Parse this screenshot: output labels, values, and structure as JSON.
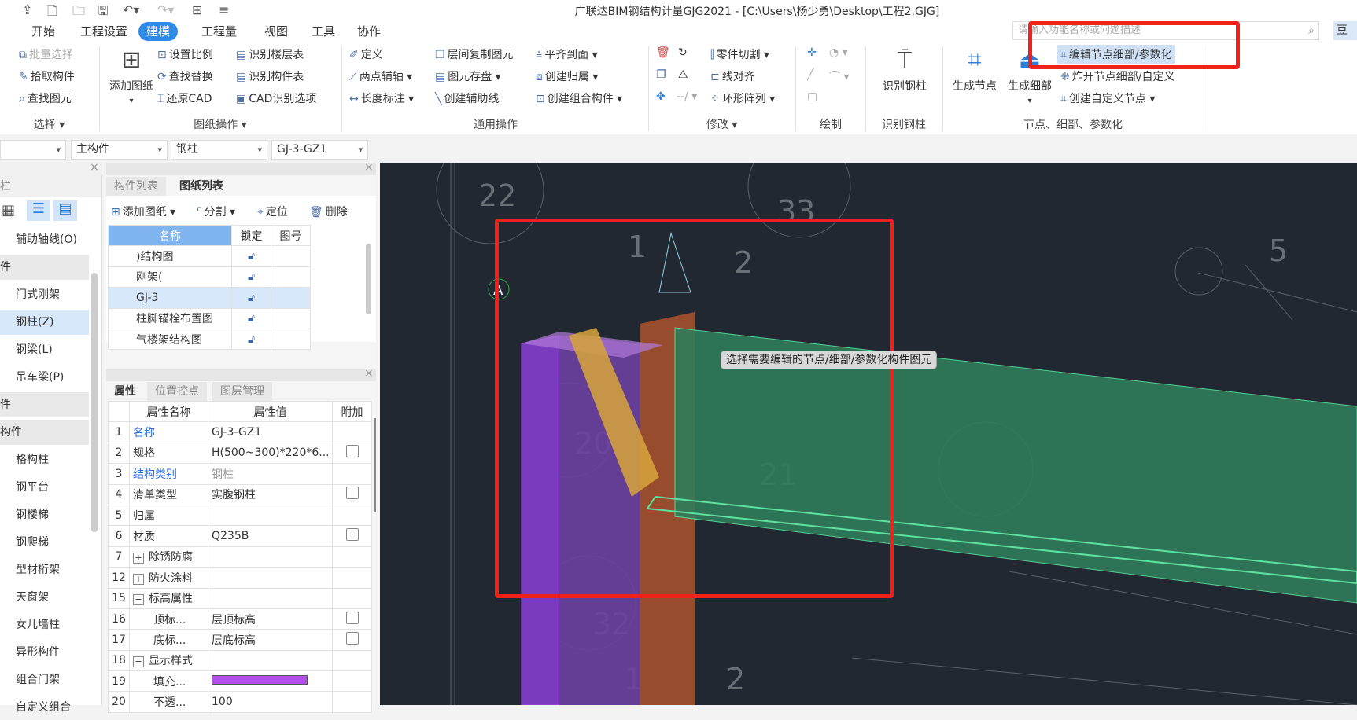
{
  "window": {
    "title": "广联达BIM钢结构计量GJG2021 - [C:\\Users\\杨少勇\\Desktop\\工程2.GJG]"
  },
  "menu_tabs": [
    "开始",
    "工程设置",
    "建模",
    "工程量",
    "视图",
    "工具",
    "协作"
  ],
  "active_tab": "建模",
  "search": {
    "placeholder": "请输入功能名称或问题描述"
  },
  "user_label": "豆",
  "ribbon": {
    "select": {
      "label": "选择",
      "batch": "批量选择",
      "pick": "拾取构件",
      "find": "查找图元"
    },
    "drawing": {
      "label": "图纸操作",
      "add": "添加图纸",
      "scale": "设置比例",
      "replace": "查找替换",
      "restore": "还原CAD",
      "floor_table": "识别楼层表",
      "comp_table": "识别构件表",
      "cad_options": "CAD识别选项"
    },
    "common": {
      "label": "通用操作",
      "define": "定义",
      "two_point": "两点辅轴",
      "length": "长度标注",
      "copy_floor": "层间复制图元",
      "save": "图元存盘",
      "aux_line": "创建辅助线",
      "align": "平齐到面",
      "owner": "创建归属",
      "group": "创建组合构件"
    },
    "modify": {
      "label": "修改",
      "cut": "零件切割",
      "line_align": "线对齐",
      "ring": "环形阵列"
    },
    "draw": {
      "label": "绘制"
    },
    "recognize": {
      "label": "识别钢柱",
      "button": "识别钢柱"
    },
    "node": {
      "label": "节点、细部、参数化",
      "gen_node": "生成节点",
      "gen_detail": "生成细部",
      "edit": "编辑节点细部/参数化",
      "explode": "炸开节点细部/自定义",
      "custom": "创建自定义节点"
    }
  },
  "selectors": [
    "",
    "主构件",
    "钢柱",
    "GJ-3-GZ1"
  ],
  "nav": {
    "title": "栏",
    "items": [
      {
        "label": "辅助轴线(O)",
        "type": "item"
      },
      {
        "label": "件",
        "type": "header"
      },
      {
        "label": "门式刚架",
        "type": "item"
      },
      {
        "label": "钢柱(Z)",
        "type": "selected"
      },
      {
        "label": "钢梁(L)",
        "type": "item"
      },
      {
        "label": "吊车梁(P)",
        "type": "item"
      },
      {
        "label": "件",
        "type": "header"
      },
      {
        "label": "构件",
        "type": "header"
      },
      {
        "label": "格构柱",
        "type": "item"
      },
      {
        "label": "钢平台",
        "type": "item"
      },
      {
        "label": "钢楼梯",
        "type": "item"
      },
      {
        "label": "钢爬梯",
        "type": "item"
      },
      {
        "label": "型材桁架",
        "type": "item"
      },
      {
        "label": "天窗架",
        "type": "item"
      },
      {
        "label": "女儿墙柱",
        "type": "item"
      },
      {
        "label": "异形构件",
        "type": "item"
      },
      {
        "label": "组合门架",
        "type": "item"
      },
      {
        "label": "自定义组合",
        "type": "item"
      }
    ]
  },
  "drawings": {
    "tabs": [
      "构件列表",
      "图纸列表"
    ],
    "active": "图纸列表",
    "toolbar": {
      "add": "添加图纸",
      "split": "分割",
      "locate": "定位",
      "delete": "删除"
    },
    "columns": [
      "名称",
      "锁定",
      "图号"
    ],
    "rows": [
      {
        "name": ")结构图"
      },
      {
        "name": "刚架("
      },
      {
        "name": "GJ-3",
        "selected": true
      },
      {
        "name": "柱脚锚栓布置图"
      },
      {
        "name": "气楼架结构图"
      }
    ]
  },
  "properties": {
    "tabs": [
      "属性",
      "位置控点",
      "图层管理"
    ],
    "columns": [
      "属性名称",
      "属性值",
      "附加"
    ],
    "rows": [
      {
        "no": "1",
        "name": "名称",
        "value": "GJ-3-GZ1",
        "link": true,
        "check": false
      },
      {
        "no": "2",
        "name": "规格",
        "value": "H(500~300)*220*6...",
        "check": true
      },
      {
        "no": "3",
        "name": "结构类别",
        "value": "钢柱",
        "link": true,
        "grey": true,
        "check": false
      },
      {
        "no": "4",
        "name": "清单类型",
        "value": "实腹钢柱",
        "check": true
      },
      {
        "no": "5",
        "name": "归属",
        "value": "",
        "check": false
      },
      {
        "no": "6",
        "name": "材质",
        "value": "Q235B",
        "check": true
      },
      {
        "no": "7",
        "name": "除锈防腐",
        "value": "",
        "expand": "+",
        "check": false
      },
      {
        "no": "12",
        "name": "防火涂料",
        "value": "",
        "expand": "+",
        "check": false
      },
      {
        "no": "15",
        "name": "标高属性",
        "value": "",
        "expand": "−",
        "check": false
      },
      {
        "no": "16",
        "name": "顶标...",
        "value": "层顶标高",
        "child": true,
        "check": true
      },
      {
        "no": "17",
        "name": "底标...",
        "value": "层底标高",
        "child": true,
        "check": true
      },
      {
        "no": "18",
        "name": "显示样式",
        "value": "",
        "expand": "−",
        "check": false
      },
      {
        "no": "19",
        "name": "填充...",
        "value": "",
        "child": true,
        "color": "#b44ee8",
        "check": false
      },
      {
        "no": "20",
        "name": "不透...",
        "value": "100",
        "child": true,
        "check": false
      }
    ]
  },
  "viewport": {
    "tooltip": "选择需要编辑的节点/细部/参数化构件图元",
    "axis_label": "A",
    "numbers": [
      "22",
      "1",
      "2",
      "33",
      "5",
      "20",
      "21",
      "32",
      "1",
      "2"
    ],
    "colors": {
      "column": "#8a3fd0",
      "beam": "#2e7d5a",
      "stiffener": "#e0a72a",
      "highlight": "#f0201a"
    }
  }
}
